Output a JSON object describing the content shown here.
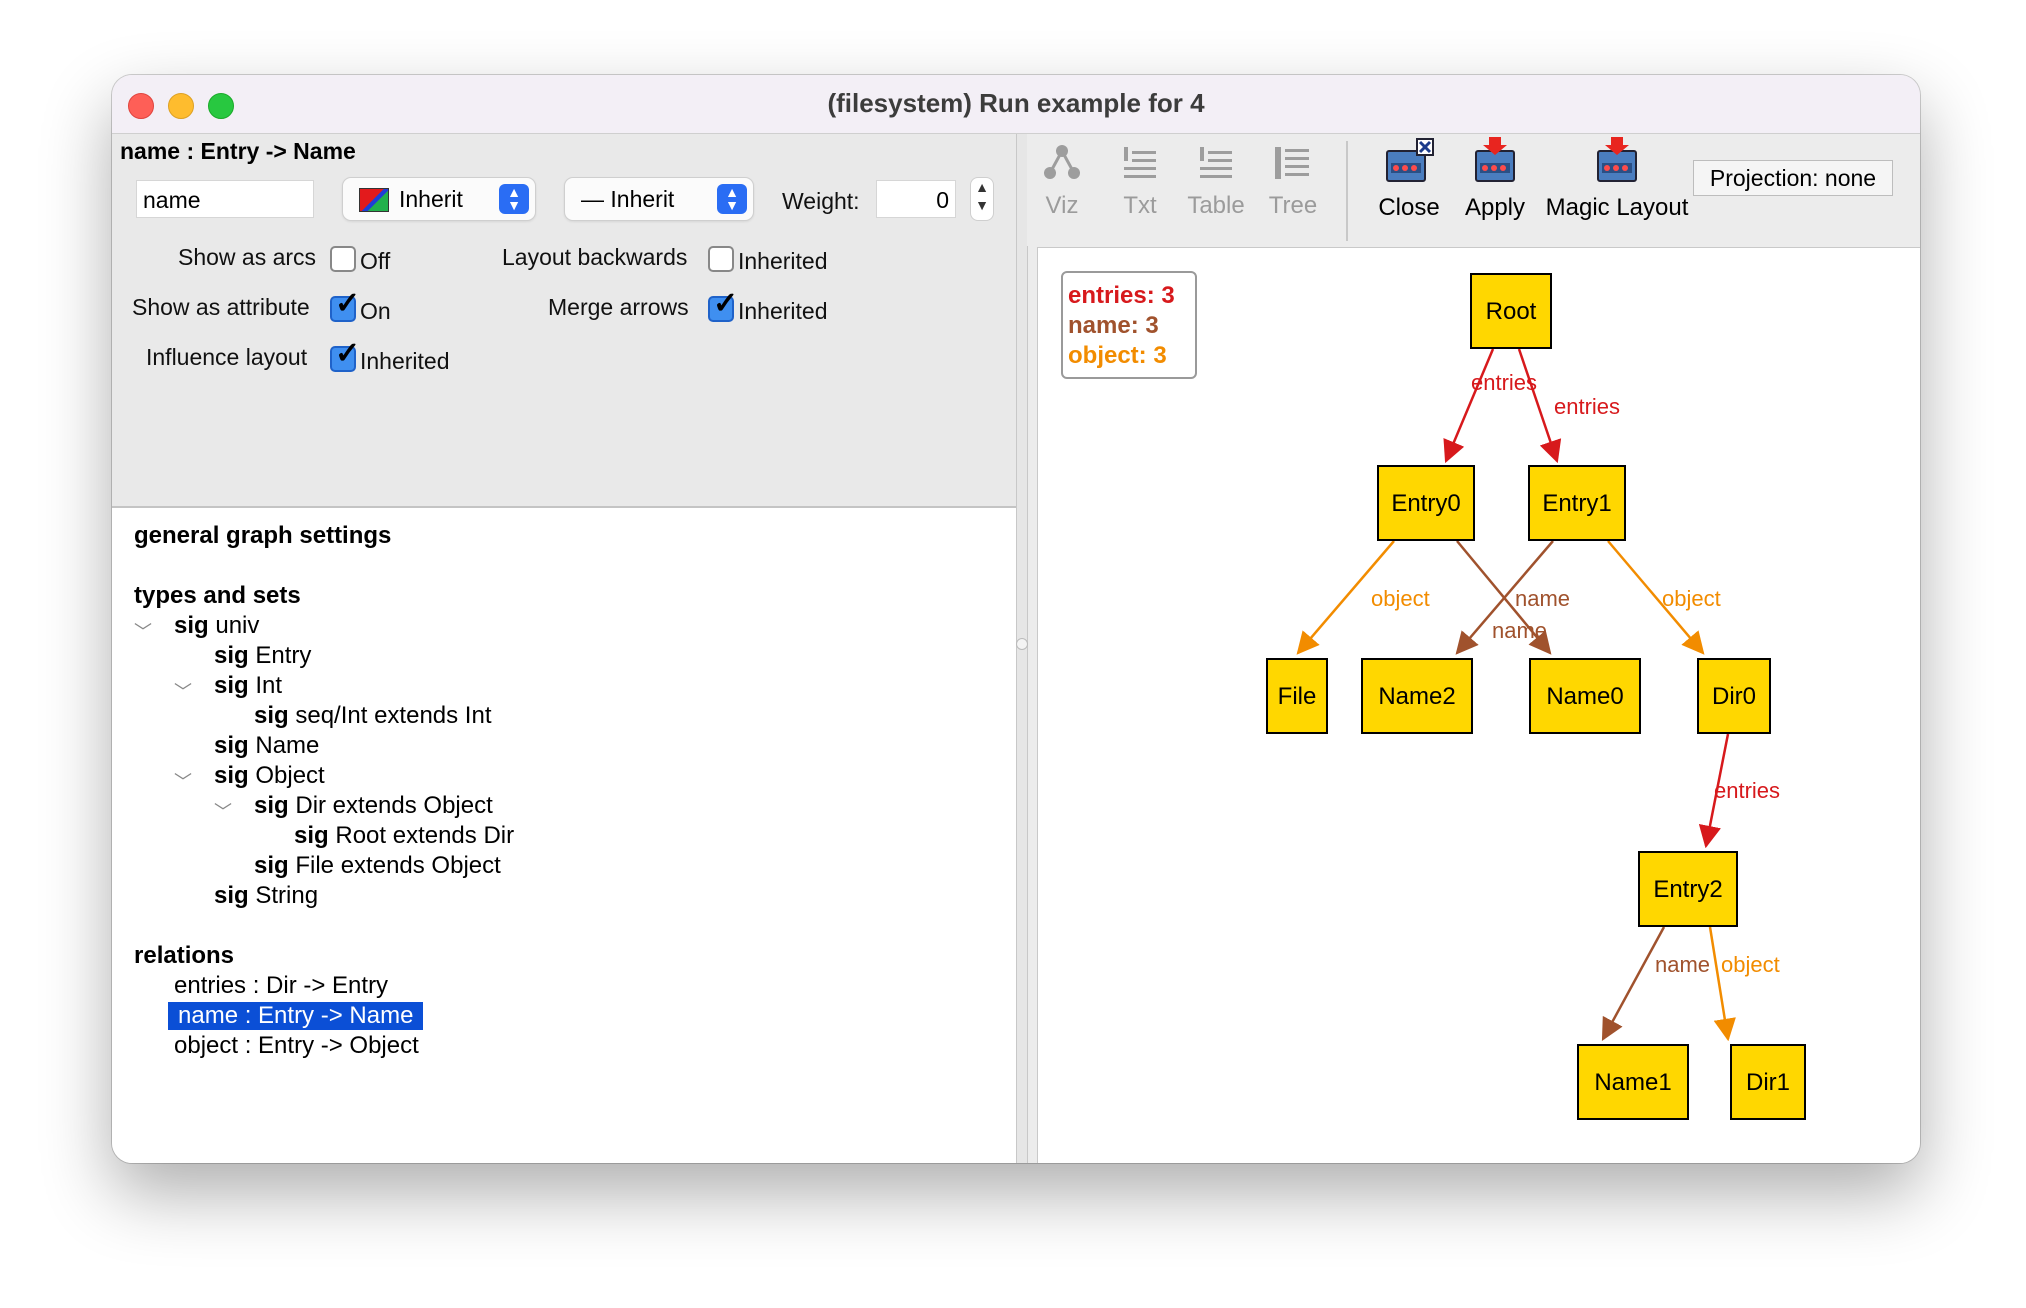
{
  "window": {
    "title": "(filesystem) Run example for 4"
  },
  "editor": {
    "relation_title": "name : Entry -> Name",
    "name_value": "name",
    "color_combo": "Inherit",
    "style_combo": "— Inherit",
    "weight_label": "Weight:",
    "weight_value": "0",
    "show_arcs_label": "Show as arcs",
    "show_arcs_state": "Off",
    "show_attr_label": "Show as attribute",
    "show_attr_state": "On",
    "influence_label": "Influence layout",
    "influence_state": "Inherited",
    "layout_back_label": "Layout backwards",
    "layout_back_state": "Inherited",
    "merge_label": "Merge arrows",
    "merge_state": "Inherited"
  },
  "settings_tree": {
    "general": "general graph settings",
    "types_heading": "types and sets",
    "sig_kw": "sig",
    "sigs": [
      {
        "name": "univ"
      },
      {
        "name": "Entry"
      },
      {
        "name": "Int"
      },
      {
        "name": "seq/Int extends Int"
      },
      {
        "name": "Name"
      },
      {
        "name": "Object"
      },
      {
        "name": "Dir extends Object"
      },
      {
        "name": "Root extends Dir"
      },
      {
        "name": "File extends Object"
      },
      {
        "name": "String"
      }
    ],
    "relations_heading": "relations",
    "relations": [
      {
        "label": "entries :  Dir -> Entry"
      },
      {
        "label": "name :  Entry -> Name"
      },
      {
        "label": "object :  Entry -> Object"
      }
    ]
  },
  "toolbar": {
    "viz": "Viz",
    "txt": "Txt",
    "table": "Table",
    "tree": "Tree",
    "close": "Close",
    "apply": "Apply",
    "magic": "Magic Layout",
    "projection": "Projection: none"
  },
  "legend": [
    {
      "label": "entries: 3",
      "color": "#d7191c"
    },
    {
      "label": "name: 3",
      "color": "#a0522d"
    },
    {
      "label": "object: 3",
      "color": "#f28c00"
    }
  ],
  "graph": {
    "colors": {
      "entries": "#d7191c",
      "name": "#a0522d",
      "object": "#f28c00",
      "node_fill": "#ffd700"
    },
    "nodes": [
      {
        "id": "Root",
        "label": "Root"
      },
      {
        "id": "Entry0",
        "label": "Entry0"
      },
      {
        "id": "Entry1",
        "label": "Entry1"
      },
      {
        "id": "File",
        "label": "File"
      },
      {
        "id": "Name2",
        "label": "Name2"
      },
      {
        "id": "Name0",
        "label": "Name0"
      },
      {
        "id": "Dir0",
        "label": "Dir0"
      },
      {
        "id": "Entry2",
        "label": "Entry2"
      },
      {
        "id": "Name1",
        "label": "Name1"
      },
      {
        "id": "Dir1",
        "label": "Dir1"
      }
    ],
    "edges": [
      {
        "from": "Root",
        "to": "Entry0",
        "rel": "entries",
        "label": "entries"
      },
      {
        "from": "Root",
        "to": "Entry1",
        "rel": "entries",
        "label": "entries"
      },
      {
        "from": "Entry0",
        "to": "File",
        "rel": "object",
        "label": "object"
      },
      {
        "from": "Entry0",
        "to": "Name0",
        "rel": "name",
        "label": "name"
      },
      {
        "from": "Entry1",
        "to": "Name2",
        "rel": "name",
        "label": "name"
      },
      {
        "from": "Entry1",
        "to": "Dir0",
        "rel": "object",
        "label": "object"
      },
      {
        "from": "Dir0",
        "to": "Entry2",
        "rel": "entries",
        "label": "entries"
      },
      {
        "from": "Entry2",
        "to": "Name1",
        "rel": "name",
        "label": "name"
      },
      {
        "from": "Entry2",
        "to": "Dir1",
        "rel": "object",
        "label": "object"
      }
    ]
  }
}
